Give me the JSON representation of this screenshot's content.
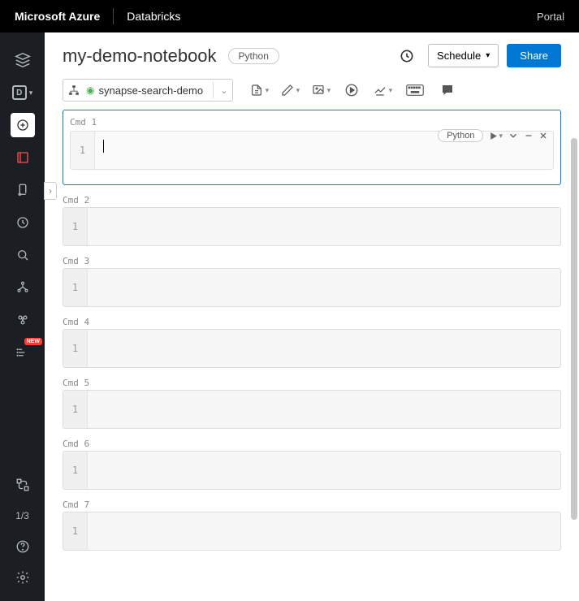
{
  "topbar": {
    "brand": "Microsoft Azure",
    "product": "Databricks",
    "portal": "Portal"
  },
  "sidebar": {
    "badge_new": "NEW",
    "counter": "1/3"
  },
  "header": {
    "title": "my-demo-notebook",
    "language_pill": "Python",
    "schedule_label": "Schedule",
    "share_label": "Share"
  },
  "toolbar": {
    "cluster_name": "synapse-search-demo"
  },
  "cells": [
    {
      "label": "Cmd 1",
      "line": "1",
      "active": true,
      "lang_pill": "Python"
    },
    {
      "label": "Cmd 2",
      "line": "1",
      "active": false
    },
    {
      "label": "Cmd 3",
      "line": "1",
      "active": false
    },
    {
      "label": "Cmd 4",
      "line": "1",
      "active": false
    },
    {
      "label": "Cmd 5",
      "line": "1",
      "active": false
    },
    {
      "label": "Cmd 6",
      "line": "1",
      "active": false
    },
    {
      "label": "Cmd 7",
      "line": "1",
      "active": false
    }
  ]
}
